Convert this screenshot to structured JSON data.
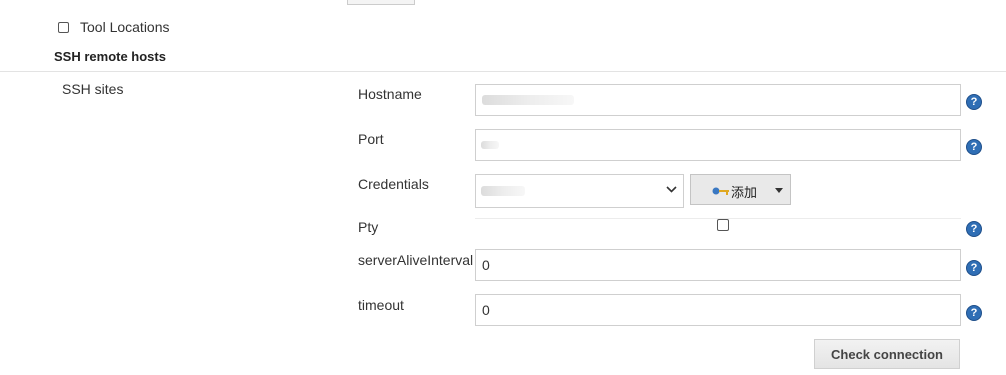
{
  "tool_locations": {
    "label": "Tool Locations",
    "checked": false
  },
  "section": {
    "title": "SSH remote hosts"
  },
  "ssh_sites": {
    "label": "SSH sites",
    "hostname": {
      "label": "Hostname",
      "value": ""
    },
    "port": {
      "label": "Port",
      "value": ""
    },
    "credentials": {
      "label": "Credentials",
      "add_button": {
        "label": "添加",
        "icon": "key-icon"
      }
    },
    "pty": {
      "label": "Pty",
      "checked": false
    },
    "server_alive_interval": {
      "label": "serverAliveInterval",
      "value": "0"
    },
    "timeout": {
      "label": "timeout",
      "value": "0"
    },
    "check_button": {
      "label": "Check connection"
    }
  },
  "help_icon": {
    "glyph": "?",
    "color": "#2f6eb5"
  }
}
